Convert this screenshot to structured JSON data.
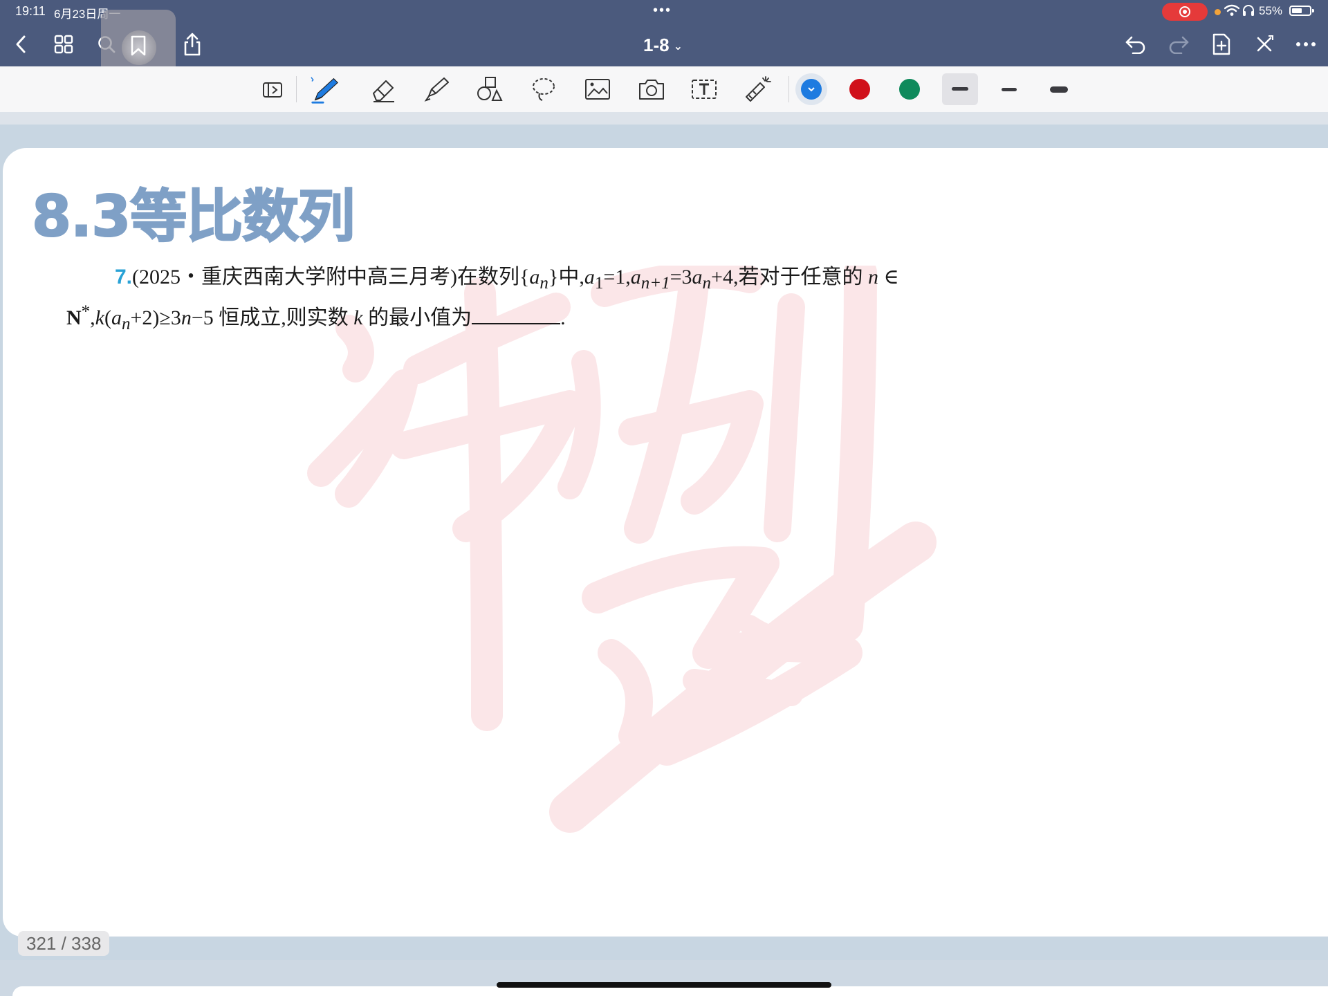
{
  "status_bar": {
    "time": "19:11",
    "date": "6月23日周一",
    "battery_percent": "55%",
    "battery_level": 0.55,
    "recording": true,
    "accent_colors": {
      "recording": "#e53a3a",
      "mic_dot": "#f2a33a"
    }
  },
  "nav_bar": {
    "page_range": "1-8",
    "icons": [
      "chevron-left-icon",
      "grid-icon",
      "search-icon",
      "bookmark-icon",
      "share-icon",
      "undo-icon",
      "redo-icon",
      "add-page-icon",
      "close-icon",
      "more-icon"
    ]
  },
  "toolbar": {
    "tools": [
      "read-mode-icon",
      "pen-icon",
      "eraser-icon",
      "highlighter-icon",
      "shapes-icon",
      "lasso-icon",
      "image-icon",
      "camera-icon",
      "textbox-icon",
      "laser-pointer-icon"
    ],
    "selected_tool": "pen",
    "colors": [
      "#1e7be0",
      "#d0101a",
      "#0f8a5c"
    ],
    "selected_color": "#1e7be0",
    "stroke_widths": [
      "medium",
      "thin",
      "thick"
    ],
    "selected_stroke": "medium"
  },
  "document": {
    "section_title": "8.3等比数列",
    "question": {
      "number": "7.",
      "source": "(2025・重庆西南大学附中高三月考)",
      "line1_a": "在数列{",
      "line1_b": "}中,",
      "line1_c": "=1,",
      "line1_d": "=3",
      "line1_e": "+4,若对于任意的",
      "line1_f": "∈",
      "line2_a": ",",
      "line2_b": "(",
      "line2_c": "+2)≥3",
      "line2_d": "−5 恒成立,则实数",
      "line2_e": "的最小值为",
      "line2_end": "."
    },
    "watermark_text": "冲刺"
  },
  "footer": {
    "page_counter": "321 / 338"
  }
}
